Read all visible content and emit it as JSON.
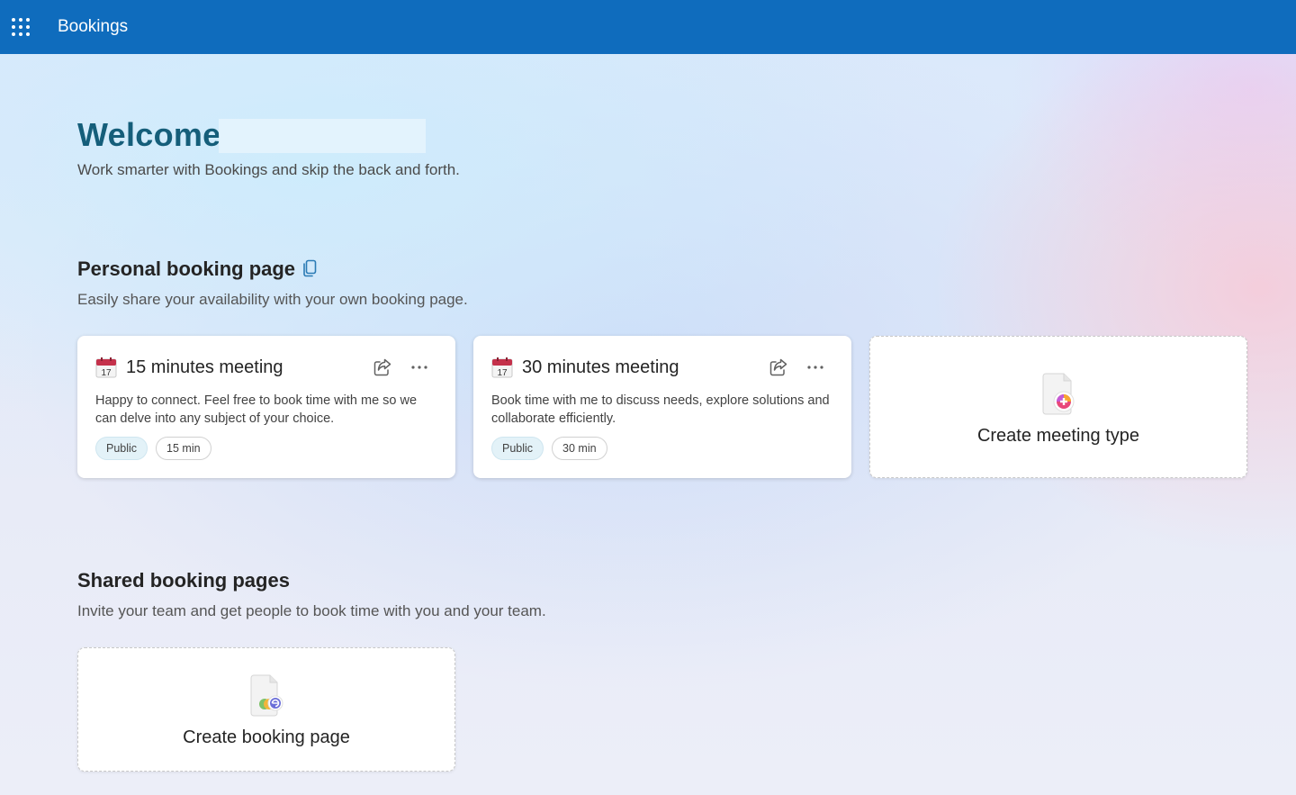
{
  "app": {
    "title": "Bookings"
  },
  "welcome": {
    "title": "Welcome",
    "subtitle": "Work smarter with Bookings and skip the back and forth."
  },
  "personal": {
    "title": "Personal booking page",
    "description": "Easily share your availability with your own booking page.",
    "cards": [
      {
        "calendar_day": "17",
        "title": "15 minutes meeting",
        "description": "Happy to connect. Feel free to book time with me so we can delve into any subject of your choice.",
        "visibility": "Public",
        "duration": "15 min",
        "more": "···"
      },
      {
        "calendar_day": "17",
        "title": "30 minutes meeting",
        "description": "Book time with me to discuss needs, explore solutions and collaborate efficiently.",
        "visibility": "Public",
        "duration": "30 min",
        "more": "···"
      }
    ],
    "create_label": "Create meeting type"
  },
  "shared": {
    "title": "Shared booking pages",
    "description": "Invite your team and get people to book time with you and your team.",
    "create_label": "Create booking page"
  },
  "colors": {
    "topbar": "#0f6cbd",
    "welcome_title": "#155e7a",
    "public_tag": "#e3f2f8",
    "calendar_red": "#c4314b"
  },
  "icons": {
    "waffle": "app-launcher-icon",
    "copy": "copy-icon",
    "calendar": "calendar-icon",
    "share": "share-icon",
    "more": "more-options-icon",
    "create_meeting": "create-meeting-type-icon",
    "create_page": "create-booking-page-icon"
  }
}
